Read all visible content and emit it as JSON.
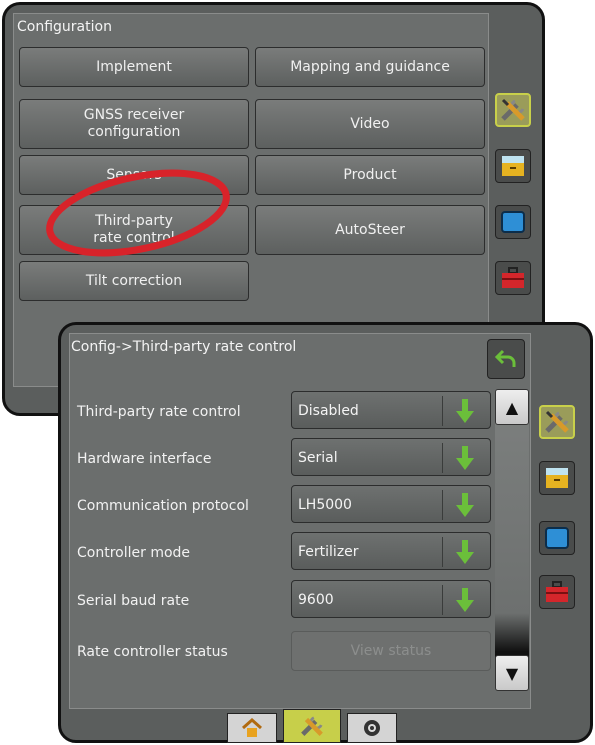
{
  "config": {
    "title": "Configuration",
    "buttons": {
      "implement": "Implement",
      "mapping_guidance": "Mapping and guidance",
      "gnss": "GNSS receiver\nconfiguration",
      "video": "Video",
      "sensors": "Sensors",
      "product": "Product",
      "third_party": "Third-party\nrate control",
      "autosteer": "AutoSteer",
      "tilt": "Tilt correction"
    }
  },
  "detail": {
    "breadcrumb": "Config->Third-party rate control",
    "rows": [
      {
        "label": "Third-party rate control",
        "value": "Disabled"
      },
      {
        "label": "Hardware interface",
        "value": "Serial"
      },
      {
        "label": "Communication protocol",
        "value": "LH5000"
      },
      {
        "label": "Controller mode",
        "value": "Fertilizer"
      },
      {
        "label": "Serial baud rate",
        "value": "9600"
      }
    ],
    "status_row": {
      "label": "Rate controller status",
      "button": "View status"
    }
  },
  "icons": {
    "tools": "wrench-screwdriver-icon",
    "storage": "storage-box-icon",
    "screen": "screen-icon",
    "toolbox": "toolbox-icon",
    "back": "back-arrow-icon",
    "home": "home-icon",
    "camera": "camera-icon"
  },
  "colors": {
    "panel": "#5b5e5d",
    "highlight_circle": "#d8232a",
    "dropdown_arrow": "#6bbf3a",
    "active_tab": "#c8d04a"
  }
}
